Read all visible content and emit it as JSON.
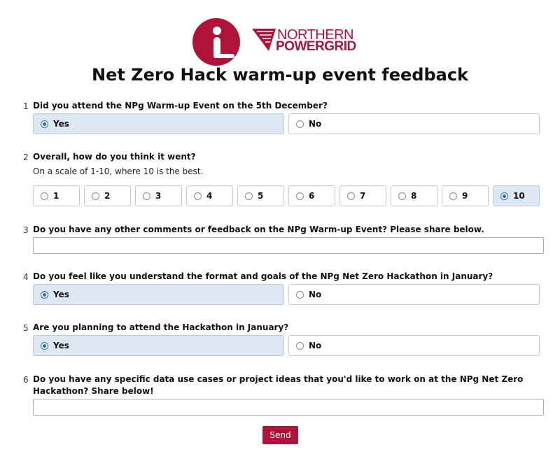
{
  "brand": {
    "primary_color": "#b0123a",
    "logo_icon": "info-person-icon",
    "name_line1": "NORTHERN",
    "name_line2": "POWERGRID"
  },
  "title": "Net Zero Hack warm-up event feedback",
  "questions": [
    {
      "number": "1",
      "text": "Did you attend the NPg Warm-up Event on the 5th December?",
      "options": [
        "Yes",
        "No"
      ],
      "selected": "Yes"
    },
    {
      "number": "2",
      "text": "Overall, how do you think it went?",
      "subtext": "On a scale of 1-10, where 10 is the best.",
      "options": [
        "1",
        "2",
        "3",
        "4",
        "5",
        "6",
        "7",
        "8",
        "9",
        "10"
      ],
      "selected": "10"
    },
    {
      "number": "3",
      "text": "Do you have any other comments or feedback on the NPg Warm-up Event? Please share below.",
      "value": ""
    },
    {
      "number": "4",
      "text": "Do you feel like you understand the format and goals of the NPg Net Zero Hackathon in January?",
      "options": [
        "Yes",
        "No"
      ],
      "selected": "Yes"
    },
    {
      "number": "5",
      "text": "Are you planning to attend the Hackathon in January?",
      "options": [
        "Yes",
        "No"
      ],
      "selected": "Yes"
    },
    {
      "number": "6",
      "text": "Do you have any specific data use cases or project ideas that you'd like to work on at the NPg Net Zero Hackathon? Share below!",
      "value": ""
    }
  ],
  "send_label": "Send"
}
